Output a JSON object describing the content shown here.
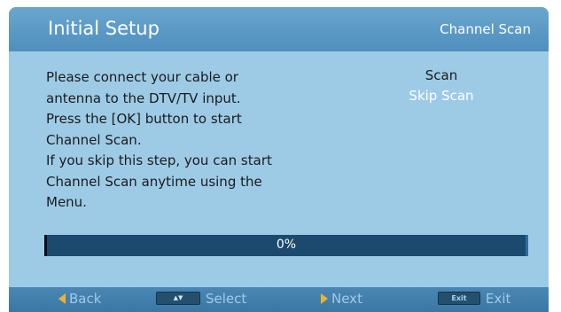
{
  "header": {
    "title": "Initial Setup",
    "subtitle": "Channel Scan"
  },
  "instructions": [
    "Please connect your cable or",
    "antenna to the DTV/TV input.",
    "Press the [OK] button to start",
    "Channel Scan.",
    "If you skip this step, you can start",
    "Channel Scan anytime using the",
    "Menu."
  ],
  "menu": {
    "scan_label": "Scan",
    "skip_label": "Skip Scan",
    "selected": "Skip Scan"
  },
  "progress": {
    "label": "0%",
    "value": 0
  },
  "footer": {
    "back_label": "Back",
    "select_key": "▲▼",
    "select_label": "Select",
    "next_label": "Next",
    "exit_key": "Exit",
    "exit_label": "Exit"
  },
  "colors": {
    "background": "#9dcbe6",
    "header": "#4f8fbd",
    "accent_arrow": "#f2b02a",
    "footer_text": "#9fcbe8"
  }
}
